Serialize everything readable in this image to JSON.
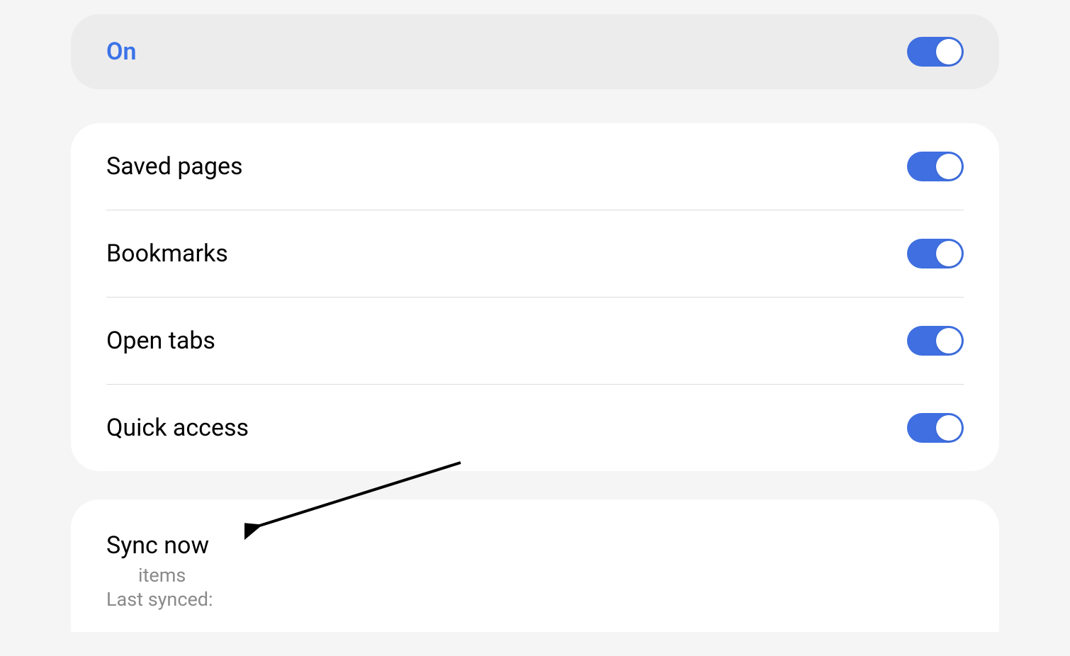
{
  "master": {
    "label": "On",
    "enabled": true
  },
  "items": [
    {
      "label": "Saved pages",
      "enabled": true
    },
    {
      "label": "Bookmarks",
      "enabled": true
    },
    {
      "label": "Open tabs",
      "enabled": true
    },
    {
      "label": "Quick access",
      "enabled": true
    }
  ],
  "sync": {
    "title": "Sync now",
    "items_line": "items",
    "last_synced_line": "Last synced:"
  }
}
